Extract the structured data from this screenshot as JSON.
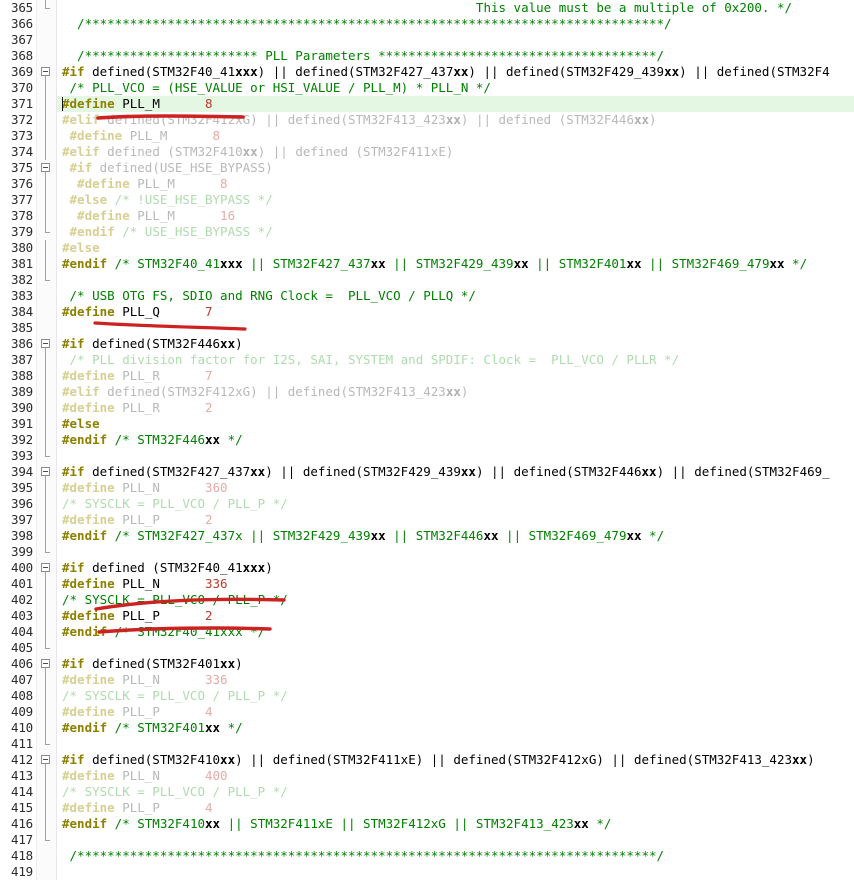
{
  "editor": {
    "app": "code-editor",
    "language": "c",
    "first_line": 365,
    "last_line": 419,
    "colors": {
      "background": "#ffffff",
      "gutter_background": "#fbfbfb",
      "line_number": "#2b2b2b",
      "keyword_preproc": "#8f8000",
      "comment": "#008000",
      "number": "#c0392b",
      "plain": "#000000",
      "inactive_plain": "#b9b9b9",
      "inactive_comment": "#aedcae",
      "current_line_highlight": "#e3f7e3",
      "annotation_red": "#cc2222"
    },
    "current_line": 371
  },
  "annotations": {
    "description": "hand-drawn red pen marks",
    "marks": [
      {
        "name": "strikethrough-line-372",
        "type": "strikethrough",
        "target_line": 372
      },
      {
        "name": "underline-line-384-pll-q",
        "type": "underline",
        "target_line": 384
      },
      {
        "name": "underline-line-402-sysclk",
        "type": "underline",
        "target_line": 402
      },
      {
        "name": "strikethrough-line-404-comment",
        "type": "strikethrough",
        "target_line": 404
      }
    ]
  },
  "lines": [
    {
      "n": 365,
      "active": true,
      "fold": "end",
      "tokens": [
        {
          "t": "plain",
          "v": "                                                       "
        },
        {
          "t": "comment",
          "v": "This value must be a multiple of 0x200. */"
        }
      ]
    },
    {
      "n": 366,
      "active": true,
      "fold": "none",
      "tokens": [
        {
          "t": "comment",
          "v": "  /*****************************************************************************/"
        }
      ]
    },
    {
      "n": 367,
      "active": true,
      "fold": "none",
      "tokens": [
        {
          "t": "plain",
          "v": ""
        }
      ]
    },
    {
      "n": 368,
      "active": true,
      "fold": "none",
      "tokens": [
        {
          "t": "comment",
          "v": "  /*********************** PLL Parameters *************************************/"
        }
      ]
    },
    {
      "n": 369,
      "active": true,
      "fold": "box",
      "tokens": [
        {
          "t": "pp",
          "v": "#if"
        },
        {
          "t": "plain",
          "v": " defined(STM32F40_41"
        },
        {
          "t": "bold",
          "v": "xxx"
        },
        {
          "t": "plain",
          "v": ") || defined(STM32F427_437"
        },
        {
          "t": "bold",
          "v": "xx"
        },
        {
          "t": "plain",
          "v": ") || defined(STM32F429_439"
        },
        {
          "t": "bold",
          "v": "xx"
        },
        {
          "t": "plain",
          "v": ") || defined(STM32F4"
        }
      ]
    },
    {
      "n": 370,
      "active": true,
      "fold": "line",
      "tokens": [
        {
          "t": "comment",
          "v": " /* PLL_VCO = (HSE_VALUE or HSI_VALUE / PLL_M) * PLL_N */"
        }
      ]
    },
    {
      "n": 371,
      "active": true,
      "fold": "line",
      "current": true,
      "caret": true,
      "tokens": [
        {
          "t": "pp",
          "v": "#define"
        },
        {
          "t": "plain",
          "v": " PLL_M      "
        },
        {
          "t": "num",
          "v": "8"
        }
      ]
    },
    {
      "n": 372,
      "active": false,
      "fold": "line",
      "tokens": [
        {
          "t": "pp",
          "v": "#elif"
        },
        {
          "t": "plain",
          "v": " defined(STM32F412xG) || defined(STM32F413_423"
        },
        {
          "t": "bold",
          "v": "xx"
        },
        {
          "t": "plain",
          "v": ") || defined (STM32F446"
        },
        {
          "t": "bold",
          "v": "xx"
        },
        {
          "t": "plain",
          "v": ")"
        }
      ]
    },
    {
      "n": 373,
      "active": false,
      "fold": "line",
      "tokens": [
        {
          "t": "pp",
          "v": " #define"
        },
        {
          "t": "plain",
          "v": " PLL_M      "
        },
        {
          "t": "num",
          "v": "8"
        }
      ]
    },
    {
      "n": 374,
      "active": false,
      "fold": "line",
      "tokens": [
        {
          "t": "pp",
          "v": "#elif"
        },
        {
          "t": "plain",
          "v": " defined (STM32F410"
        },
        {
          "t": "bold",
          "v": "xx"
        },
        {
          "t": "plain",
          "v": ") || defined (STM32F411xE)"
        }
      ]
    },
    {
      "n": 375,
      "active": false,
      "fold": "box",
      "tokens": [
        {
          "t": "pp",
          "v": " #if"
        },
        {
          "t": "plain",
          "v": " defined(USE_HSE_BYPASS)"
        }
      ]
    },
    {
      "n": 376,
      "active": false,
      "fold": "line",
      "tokens": [
        {
          "t": "pp",
          "v": "  #define"
        },
        {
          "t": "plain",
          "v": " PLL_M      "
        },
        {
          "t": "num",
          "v": "8"
        }
      ]
    },
    {
      "n": 377,
      "active": false,
      "fold": "line",
      "tokens": [
        {
          "t": "pp",
          "v": " #else"
        },
        {
          "t": "comment",
          "v": " /* !USE_HSE_BYPASS */"
        }
      ]
    },
    {
      "n": 378,
      "active": false,
      "fold": "line",
      "tokens": [
        {
          "t": "pp",
          "v": "  #define"
        },
        {
          "t": "plain",
          "v": " PLL_M      "
        },
        {
          "t": "num",
          "v": "16"
        }
      ]
    },
    {
      "n": 379,
      "active": false,
      "fold": "end",
      "tokens": [
        {
          "t": "pp",
          "v": " #endif"
        },
        {
          "t": "comment",
          "v": " /* USE_HSE_BYPASS */"
        }
      ]
    },
    {
      "n": 380,
      "active": false,
      "fold": "line",
      "tokens": [
        {
          "t": "pp",
          "v": "#else"
        }
      ]
    },
    {
      "n": 381,
      "active": true,
      "fold": "line",
      "tokens": [
        {
          "t": "pp",
          "v": "#endif"
        },
        {
          "t": "comment",
          "v": " /* STM32F40_41"
        },
        {
          "t": "bold",
          "v": "xxx"
        },
        {
          "t": "comment",
          "v": " || STM32F427_437"
        },
        {
          "t": "bold",
          "v": "xx"
        },
        {
          "t": "comment",
          "v": " || STM32F429_439"
        },
        {
          "t": "bold",
          "v": "xx"
        },
        {
          "t": "comment",
          "v": " || STM32F401"
        },
        {
          "t": "bold",
          "v": "xx"
        },
        {
          "t": "comment",
          "v": " || STM32F469_479"
        },
        {
          "t": "bold",
          "v": "xx"
        },
        {
          "t": "comment",
          "v": " */"
        }
      ]
    },
    {
      "n": 382,
      "active": true,
      "fold": "end",
      "tokens": [
        {
          "t": "plain",
          "v": ""
        }
      ]
    },
    {
      "n": 383,
      "active": true,
      "fold": "none",
      "tokens": [
        {
          "t": "comment",
          "v": " /* USB OTG FS, SDIO and RNG Clock =  PLL_VCO / PLLQ */"
        }
      ]
    },
    {
      "n": 384,
      "active": true,
      "fold": "none",
      "tokens": [
        {
          "t": "pp",
          "v": "#define"
        },
        {
          "t": "plain",
          "v": " PLL_Q      "
        },
        {
          "t": "num",
          "v": "7"
        }
      ]
    },
    {
      "n": 385,
      "active": true,
      "fold": "none",
      "tokens": [
        {
          "t": "plain",
          "v": ""
        }
      ]
    },
    {
      "n": 386,
      "active": true,
      "fold": "box",
      "tokens": [
        {
          "t": "pp",
          "v": "#if"
        },
        {
          "t": "plain",
          "v": " defined(STM32F446"
        },
        {
          "t": "bold",
          "v": "xx"
        },
        {
          "t": "plain",
          "v": ")"
        }
      ]
    },
    {
      "n": 387,
      "active": false,
      "fold": "line",
      "tokens": [
        {
          "t": "comment",
          "v": " /* PLL division factor for I2S, SAI, SYSTEM and SPDIF: Clock =  PLL_VCO / PLLR */"
        }
      ]
    },
    {
      "n": 388,
      "active": false,
      "fold": "line",
      "tokens": [
        {
          "t": "pp",
          "v": "#define"
        },
        {
          "t": "plain",
          "v": " PLL_R      "
        },
        {
          "t": "num",
          "v": "7"
        }
      ]
    },
    {
      "n": 389,
      "active": false,
      "fold": "line",
      "tokens": [
        {
          "t": "pp",
          "v": "#elif"
        },
        {
          "t": "plain",
          "v": " defined(STM32F412xG) || defined(STM32F413_423"
        },
        {
          "t": "bold",
          "v": "xx"
        },
        {
          "t": "plain",
          "v": ")"
        }
      ]
    },
    {
      "n": 390,
      "active": false,
      "fold": "line",
      "tokens": [
        {
          "t": "pp",
          "v": "#define"
        },
        {
          "t": "plain",
          "v": " PLL_R      "
        },
        {
          "t": "num",
          "v": "2"
        }
      ]
    },
    {
      "n": 391,
      "active": true,
      "fold": "line",
      "tokens": [
        {
          "t": "pp",
          "v": "#else"
        }
      ]
    },
    {
      "n": 392,
      "active": true,
      "fold": "line",
      "tokens": [
        {
          "t": "pp",
          "v": "#endif"
        },
        {
          "t": "comment",
          "v": " /* STM32F446"
        },
        {
          "t": "bold",
          "v": "xx"
        },
        {
          "t": "comment",
          "v": " */"
        }
      ]
    },
    {
      "n": 393,
      "active": true,
      "fold": "end",
      "tokens": [
        {
          "t": "plain",
          "v": ""
        }
      ]
    },
    {
      "n": 394,
      "active": true,
      "fold": "box",
      "tokens": [
        {
          "t": "pp",
          "v": "#if"
        },
        {
          "t": "plain",
          "v": " defined(STM32F427_437"
        },
        {
          "t": "bold",
          "v": "xx"
        },
        {
          "t": "plain",
          "v": ") || defined(STM32F429_439"
        },
        {
          "t": "bold",
          "v": "xx"
        },
        {
          "t": "plain",
          "v": ") || defined(STM32F446"
        },
        {
          "t": "bold",
          "v": "xx"
        },
        {
          "t": "plain",
          "v": ") || defined(STM32F469_"
        }
      ]
    },
    {
      "n": 395,
      "active": false,
      "fold": "line",
      "tokens": [
        {
          "t": "pp",
          "v": "#define"
        },
        {
          "t": "plain",
          "v": " PLL_N      "
        },
        {
          "t": "num",
          "v": "360"
        }
      ]
    },
    {
      "n": 396,
      "active": false,
      "fold": "line",
      "tokens": [
        {
          "t": "comment",
          "v": "/* SYSCLK = PLL_VCO / PLL_P */"
        }
      ]
    },
    {
      "n": 397,
      "active": false,
      "fold": "line",
      "tokens": [
        {
          "t": "pp",
          "v": "#define"
        },
        {
          "t": "plain",
          "v": " PLL_P      "
        },
        {
          "t": "num",
          "v": "2"
        }
      ]
    },
    {
      "n": 398,
      "active": true,
      "fold": "line",
      "tokens": [
        {
          "t": "pp",
          "v": "#endif"
        },
        {
          "t": "comment",
          "v": " /* STM32F427_437x || STM32F429_439"
        },
        {
          "t": "bold",
          "v": "xx"
        },
        {
          "t": "comment",
          "v": " || STM32F446"
        },
        {
          "t": "bold",
          "v": "xx"
        },
        {
          "t": "comment",
          "v": " || STM32F469_479"
        },
        {
          "t": "bold",
          "v": "xx"
        },
        {
          "t": "comment",
          "v": " */"
        }
      ]
    },
    {
      "n": 399,
      "active": true,
      "fold": "end",
      "tokens": [
        {
          "t": "plain",
          "v": ""
        }
      ]
    },
    {
      "n": 400,
      "active": true,
      "fold": "box",
      "tokens": [
        {
          "t": "pp",
          "v": "#if"
        },
        {
          "t": "plain",
          "v": " defined (STM32F40_41"
        },
        {
          "t": "bold",
          "v": "xxx"
        },
        {
          "t": "plain",
          "v": ")"
        }
      ]
    },
    {
      "n": 401,
      "active": true,
      "fold": "line",
      "tokens": [
        {
          "t": "pp",
          "v": "#define"
        },
        {
          "t": "plain",
          "v": " PLL_N      "
        },
        {
          "t": "num",
          "v": "336"
        }
      ]
    },
    {
      "n": 402,
      "active": true,
      "fold": "line",
      "tokens": [
        {
          "t": "comment",
          "v": "/* SYSCLK = PLL_VCO / PLL_P */"
        }
      ]
    },
    {
      "n": 403,
      "active": true,
      "fold": "line",
      "tokens": [
        {
          "t": "pp",
          "v": "#define"
        },
        {
          "t": "plain",
          "v": " PLL_P      "
        },
        {
          "t": "num",
          "v": "2"
        }
      ]
    },
    {
      "n": 404,
      "active": true,
      "fold": "line",
      "tokens": [
        {
          "t": "pp",
          "v": "#endif"
        },
        {
          "t": "comment",
          "v": " /* STM32F40_41xxx */"
        }
      ]
    },
    {
      "n": 405,
      "active": true,
      "fold": "end",
      "tokens": [
        {
          "t": "plain",
          "v": ""
        }
      ]
    },
    {
      "n": 406,
      "active": true,
      "fold": "box",
      "tokens": [
        {
          "t": "pp",
          "v": "#if"
        },
        {
          "t": "plain",
          "v": " defined(STM32F401"
        },
        {
          "t": "bold",
          "v": "xx"
        },
        {
          "t": "plain",
          "v": ")"
        }
      ]
    },
    {
      "n": 407,
      "active": false,
      "fold": "line",
      "tokens": [
        {
          "t": "pp",
          "v": "#define"
        },
        {
          "t": "plain",
          "v": " PLL_N      "
        },
        {
          "t": "num",
          "v": "336"
        }
      ]
    },
    {
      "n": 408,
      "active": false,
      "fold": "line",
      "tokens": [
        {
          "t": "comment",
          "v": "/* SYSCLK = PLL_VCO / PLL_P */"
        }
      ]
    },
    {
      "n": 409,
      "active": false,
      "fold": "line",
      "tokens": [
        {
          "t": "pp",
          "v": "#define"
        },
        {
          "t": "plain",
          "v": " PLL_P      "
        },
        {
          "t": "num",
          "v": "4"
        }
      ]
    },
    {
      "n": 410,
      "active": true,
      "fold": "line",
      "tokens": [
        {
          "t": "pp",
          "v": "#endif"
        },
        {
          "t": "comment",
          "v": " /* STM32F401"
        },
        {
          "t": "bold",
          "v": "xx"
        },
        {
          "t": "comment",
          "v": " */"
        }
      ]
    },
    {
      "n": 411,
      "active": true,
      "fold": "end",
      "tokens": [
        {
          "t": "plain",
          "v": ""
        }
      ]
    },
    {
      "n": 412,
      "active": true,
      "fold": "box",
      "tokens": [
        {
          "t": "pp",
          "v": "#if"
        },
        {
          "t": "plain",
          "v": " defined(STM32F410"
        },
        {
          "t": "bold",
          "v": "xx"
        },
        {
          "t": "plain",
          "v": ") || defined(STM32F411xE) || defined(STM32F412xG) || defined(STM32F413_423"
        },
        {
          "t": "bold",
          "v": "xx"
        },
        {
          "t": "plain",
          "v": ")"
        }
      ]
    },
    {
      "n": 413,
      "active": false,
      "fold": "line",
      "tokens": [
        {
          "t": "pp",
          "v": "#define"
        },
        {
          "t": "plain",
          "v": " PLL_N      "
        },
        {
          "t": "num",
          "v": "400"
        }
      ]
    },
    {
      "n": 414,
      "active": false,
      "fold": "line",
      "tokens": [
        {
          "t": "comment",
          "v": "/* SYSCLK = PLL_VCO / PLL_P */"
        }
      ]
    },
    {
      "n": 415,
      "active": false,
      "fold": "line",
      "tokens": [
        {
          "t": "pp",
          "v": "#define"
        },
        {
          "t": "plain",
          "v": " PLL_P      "
        },
        {
          "t": "num",
          "v": "4"
        }
      ]
    },
    {
      "n": 416,
      "active": true,
      "fold": "line",
      "tokens": [
        {
          "t": "pp",
          "v": "#endif"
        },
        {
          "t": "comment",
          "v": " /* STM32F410"
        },
        {
          "t": "bold",
          "v": "xx"
        },
        {
          "t": "comment",
          "v": " || STM32F411xE || STM32F412xG || STM32F413_423"
        },
        {
          "t": "bold",
          "v": "xx"
        },
        {
          "t": "comment",
          "v": " */"
        }
      ]
    },
    {
      "n": 417,
      "active": true,
      "fold": "end",
      "tokens": [
        {
          "t": "plain",
          "v": ""
        }
      ]
    },
    {
      "n": 418,
      "active": true,
      "fold": "none",
      "tokens": [
        {
          "t": "comment",
          "v": " /*****************************************************************************/"
        }
      ]
    },
    {
      "n": 419,
      "active": true,
      "fold": "none",
      "tokens": [
        {
          "t": "plain",
          "v": ""
        }
      ]
    }
  ]
}
